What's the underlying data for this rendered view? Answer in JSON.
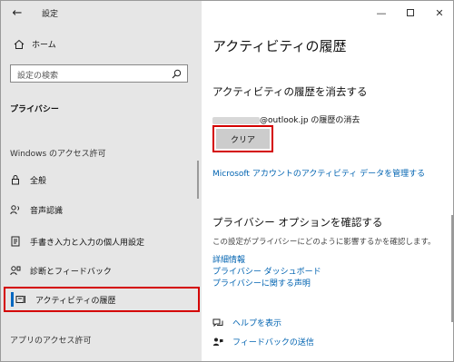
{
  "titlebar": {
    "title": "設定",
    "back_icon": "←",
    "min_icon": "—",
    "close_icon": "✕"
  },
  "sidebar": {
    "home": "ホーム",
    "search_placeholder": "設定の検索",
    "section": "プライバシー",
    "group_windows": "Windows のアクセス許可",
    "items": [
      {
        "label": "全般",
        "icon": "lock-icon"
      },
      {
        "label": "音声認識",
        "icon": "speech-icon"
      },
      {
        "label": "手書き入力と入力の個人用設定",
        "icon": "handwriting-icon"
      },
      {
        "label": "診断とフィードバック",
        "icon": "diagnostics-icon"
      },
      {
        "label": "アクティビティの履歴",
        "icon": "activity-history-icon"
      }
    ],
    "group_apps": "アプリのアクセス許可"
  },
  "content": {
    "title": "アクティビティの履歴",
    "clear_heading": "アクティビティの履歴を消去する",
    "account_suffix": "@outlook.jp の履歴の消去",
    "clear_button": "クリア",
    "manage_link": "Microsoft アカウントのアクティビティ データを管理する",
    "privacy_heading": "プライバシー オプションを確認する",
    "privacy_desc": "この設定がプライバシーにどのように影響するかを確認します。",
    "links": [
      "詳細情報",
      "プライバシー ダッシュボード",
      "プライバシーに関する声明"
    ],
    "help": "ヘルプを表示",
    "feedback": "フィードバックの送信"
  },
  "colors": {
    "accent": "#0067c0",
    "link": "#0063b1",
    "highlight": "#d40000",
    "sidebar_bg": "#e6e6e6"
  }
}
